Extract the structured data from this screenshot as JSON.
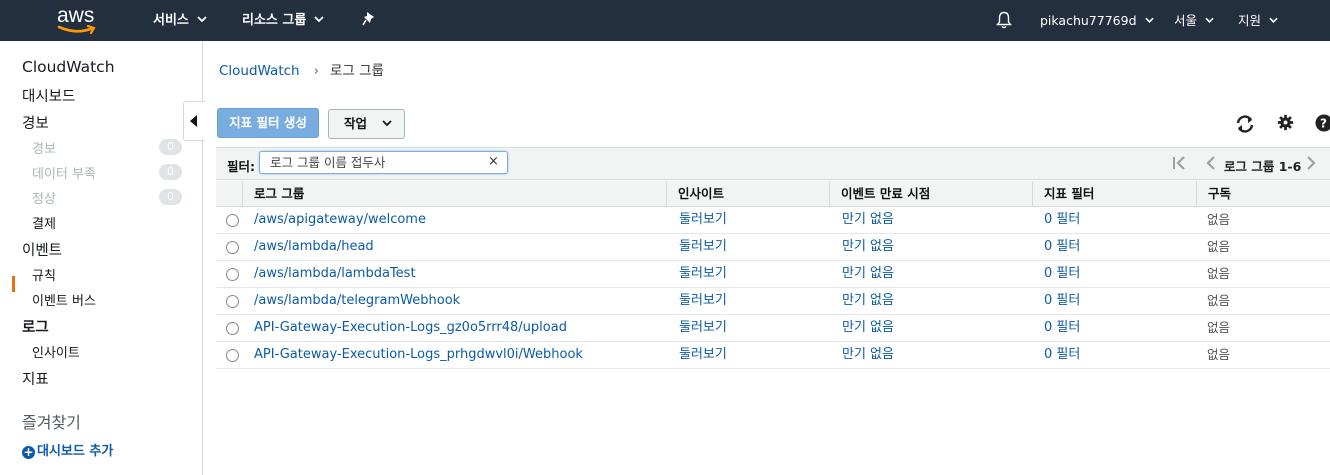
{
  "topnav": {
    "logo_text": "aws",
    "services": "서비스",
    "resource_groups": "리소스 그룹",
    "account": "pikachu77769d",
    "region": "서울",
    "support": "지원",
    "icons": [
      "pin-icon",
      "bell-icon",
      "chevron-down-icon"
    ]
  },
  "sidebar": {
    "title": "CloudWatch",
    "dashboards": "대시보드",
    "alarms": "경보",
    "alarm_sub": [
      {
        "label": "경보",
        "count": "0"
      },
      {
        "label": "데이터 부족",
        "count": "0"
      },
      {
        "label": "정상",
        "count": "0"
      }
    ],
    "billing": "결제",
    "events": "이벤트",
    "rules": "규칙",
    "event_buses": "이벤트 버스",
    "logs": "로그",
    "insights": "인사이트",
    "metrics": "지표",
    "favorites": "즐겨찾기",
    "add_dashboard": "대시보드 추가"
  },
  "breadcrumb": {
    "root": "CloudWatch",
    "separator": "›",
    "current": "로그 그룹"
  },
  "toolbar": {
    "create_metric_filter": "지표 필터 생성",
    "actions": "작업"
  },
  "filter": {
    "label": "필터:",
    "placeholder": "로그 그룹 이름 접두사",
    "clear": "×",
    "pager": "로그 그룹 1-6"
  },
  "table": {
    "headers": [
      "로그 그룹",
      "인사이트",
      "이벤트 만료 시점",
      "지표 필터",
      "구독"
    ],
    "rows": [
      {
        "name": "/aws/apigateway/welcome",
        "insights": "둘러보기",
        "expire": "만기 없음",
        "filters": "0 필터",
        "subscription": "없음"
      },
      {
        "name": "/aws/lambda/head",
        "insights": "둘러보기",
        "expire": "만기 없음",
        "filters": "0 필터",
        "subscription": "없음"
      },
      {
        "name": "/aws/lambda/lambdaTest",
        "insights": "둘러보기",
        "expire": "만기 없음",
        "filters": "0 필터",
        "subscription": "없음"
      },
      {
        "name": "/aws/lambda/telegramWebhook",
        "insights": "둘러보기",
        "expire": "만기 없음",
        "filters": "0 필터",
        "subscription": "없음"
      },
      {
        "name": "API-Gateway-Execution-Logs_gz0o5rrr48/upload",
        "insights": "둘러보기",
        "expire": "만기 없음",
        "filters": "0 필터",
        "subscription": "없음"
      },
      {
        "name": "API-Gateway-Execution-Logs_prhgdwvl0i/Webhook",
        "insights": "둘러보기",
        "expire": "만기 없음",
        "filters": "0 필터",
        "subscription": "없음"
      }
    ]
  },
  "colors": {
    "nav_bg": "#232f3e",
    "link": "#0b5ba8",
    "active_marker": "#ec7211",
    "primary_button": "#7aaddf"
  }
}
